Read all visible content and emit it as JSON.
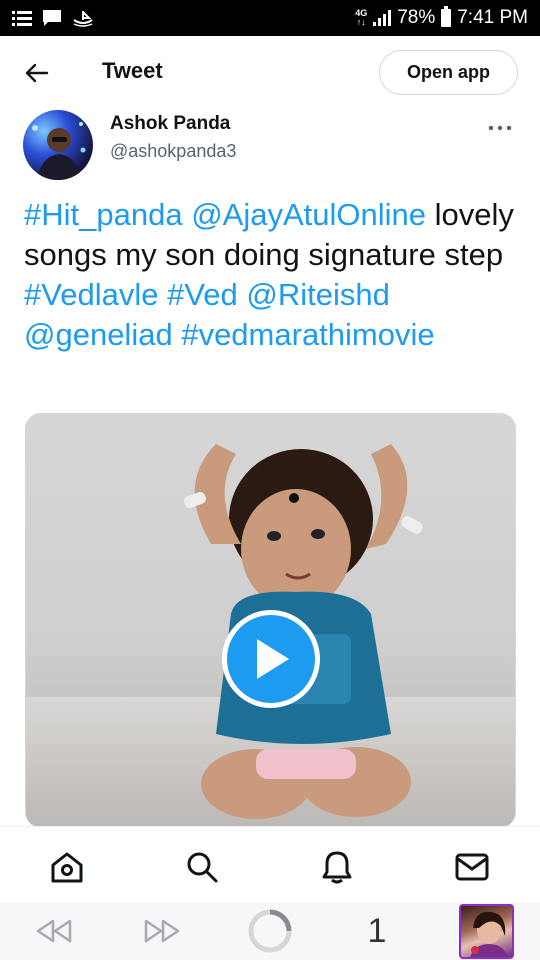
{
  "status_bar": {
    "network_type": "4G",
    "battery": "78%",
    "time": "7:41 PM"
  },
  "header": {
    "title": "Tweet",
    "open_app_label": "Open app"
  },
  "author": {
    "name": "Ashok Panda",
    "handle": "@ashokpanda3"
  },
  "tweet": {
    "segments": [
      {
        "text": "#Hit_panda",
        "link": true
      },
      {
        "text": " ",
        "link": false
      },
      {
        "text": "@AjayAtulOnline",
        "link": true
      },
      {
        "text": " lovely songs my son doing signature step ",
        "link": false
      },
      {
        "text": "#Vedlavle",
        "link": true
      },
      {
        "text": " ",
        "link": false
      },
      {
        "text": "#Ved",
        "link": true
      },
      {
        "text": " ",
        "link": false
      },
      {
        "text": "@Riteishd",
        "link": true
      },
      {
        "text": " ",
        "link": false
      },
      {
        "text": "@geneliad",
        "link": true
      },
      {
        "text": " ",
        "link": false
      },
      {
        "text": "#vedmarathimovie",
        "link": true
      }
    ]
  },
  "bottom_nav": {
    "items": [
      "home-icon",
      "search-icon",
      "notifications-icon",
      "messages-icon"
    ]
  },
  "browser_bar": {
    "tab_count": "1"
  },
  "colors": {
    "accent": "#1d9bf0",
    "text": "#0f1419",
    "secondary": "#536471"
  }
}
